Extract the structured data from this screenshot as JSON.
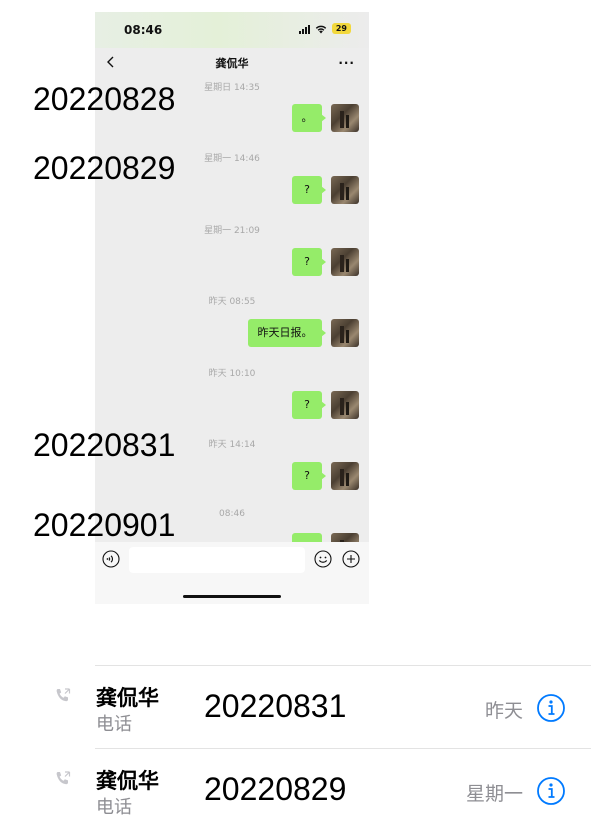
{
  "status_bar": {
    "time": "08:46",
    "battery": "29"
  },
  "chat": {
    "title": "龚侃华",
    "more_label": "···",
    "messages": [
      {
        "timestamp": "星期日 14:35",
        "text": "。"
      },
      {
        "timestamp": "星期一 14:46",
        "text": "?"
      },
      {
        "timestamp": "星期一 21:09",
        "text": "?"
      },
      {
        "timestamp": "昨天 08:55",
        "text": "昨天日报。"
      },
      {
        "timestamp": "昨天 10:10",
        "text": "?"
      },
      {
        "timestamp": "昨天 14:14",
        "text": "?"
      },
      {
        "timestamp": "08:46",
        "text": ""
      }
    ]
  },
  "annotations": [
    "20220828",
    "20220829",
    "20220831",
    "20220901"
  ],
  "call_log": [
    {
      "name": "龚侃华",
      "type": "电话",
      "date_note": "20220831",
      "time": "昨天"
    },
    {
      "name": "龚侃华",
      "type": "电话",
      "date_note": "20220829",
      "time": "星期一"
    }
  ],
  "colors": {
    "bubble_green": "#95ec69",
    "chat_background": "#ededed",
    "info_blue": "#007aff",
    "secondary_gray": "#8e8e93"
  },
  "icons": [
    "back-icon",
    "more-icon",
    "voice-icon",
    "emoji-icon",
    "plus-icon",
    "phone-call-icon",
    "info-icon"
  ]
}
